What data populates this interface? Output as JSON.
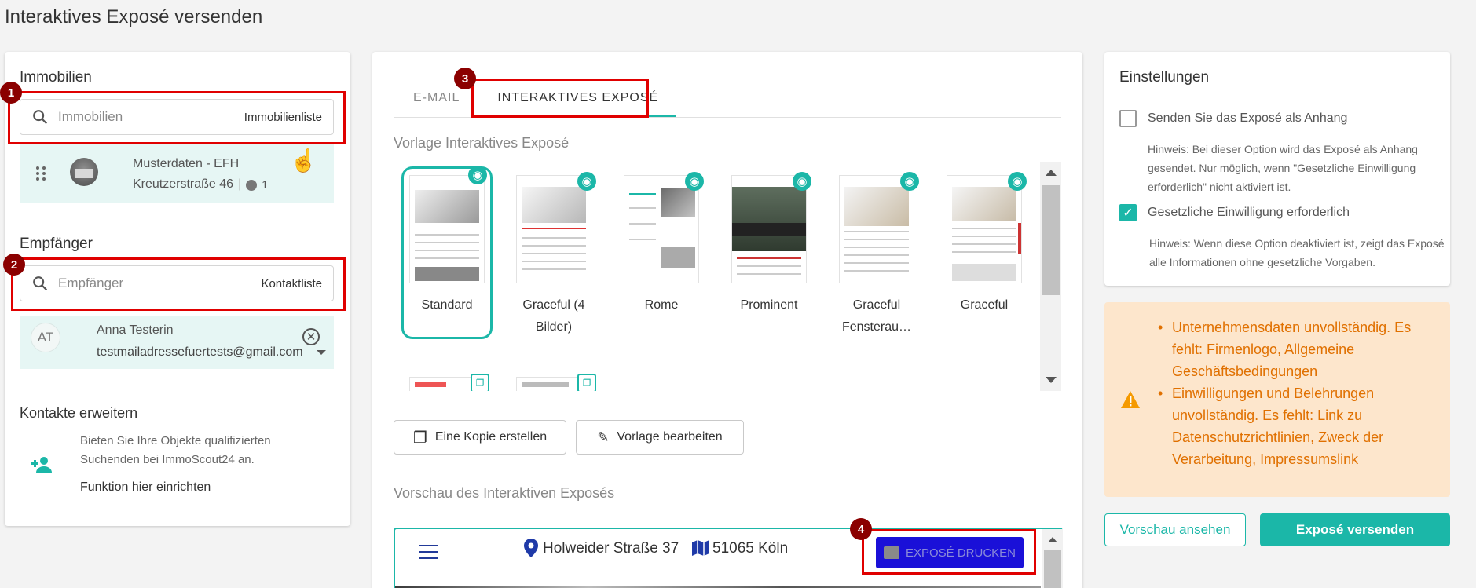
{
  "page_title": "Interaktives Exposé versenden",
  "left": {
    "immobilien": {
      "title": "Immobilien",
      "search_placeholder": "Immobilien",
      "list_link": "Immobilienliste",
      "item": {
        "name": "Musterdaten - EFH",
        "address": "Kreutzerstraße 46",
        "count": "1"
      }
    },
    "empfaenger": {
      "title": "Empfänger",
      "search_placeholder": "Empfänger",
      "list_link": "Kontaktliste",
      "item": {
        "initials": "AT",
        "name": "Anna Testerin",
        "email": "testmailadressefuertests@gmail.com"
      }
    },
    "kontakte": {
      "title": "Kontakte erweitern",
      "text": "Bieten Sie Ihre Objekte qualifizierten Suchenden bei ImmoScout24 an.",
      "link": "Funktion hier einrichten"
    }
  },
  "markers": {
    "m1": "1",
    "m2": "2",
    "m3": "3",
    "m4": "4"
  },
  "middle": {
    "tabs": [
      {
        "label": "E-MAIL"
      },
      {
        "label": "INTERAKTIVES EXPOSÉ"
      }
    ],
    "vorlage_title": "Vorlage Interaktives Exposé",
    "templates": [
      {
        "name": "Standard"
      },
      {
        "name": "Graceful (4 Bilder)"
      },
      {
        "name": "Rome"
      },
      {
        "name": "Prominent"
      },
      {
        "name": "Graceful Fensterau…"
      },
      {
        "name": "Graceful"
      }
    ],
    "copy_button": "Eine Kopie erstellen",
    "edit_button": "Vorlage bearbeiten",
    "preview_title": "Vorschau des Interaktiven Exposés",
    "preview": {
      "street": "Holweider Straße 37",
      "city": "51065 Köln",
      "print_button": "EXPOSÉ DRUCKEN"
    }
  },
  "right": {
    "settings_title": "Einstellungen",
    "opt1_label": "Senden Sie das Exposé als Anhang",
    "opt1_hint": "Hinweis: Bei dieser Option wird das Exposé als Anhang gesendet. Nur möglich, wenn \"Gesetzliche Einwilligung erforderlich\" nicht aktiviert ist.",
    "opt2_label": "Gesetzliche Einwilligung erforderlich",
    "opt2_hint": "Hinweis: Wenn diese Option deaktiviert ist, zeigt das Exposé alle Informationen ohne gesetzliche Vorgaben.",
    "warnings": [
      "Unternehmensdaten unvollständig. Es fehlt: Firmenlogo, Allgemeine Geschäftsbedingungen",
      "Einwilligungen und Belehrungen unvollständig. Es fehlt: Link zu Datenschutzrichtlinien, Zweck der Verarbeitung, Impressumslink"
    ],
    "preview_button": "Vorschau ansehen",
    "send_button": "Exposé versenden"
  },
  "colors": {
    "accent": "#1bb7a8",
    "warning": "#e07000",
    "annotation": "#e00000"
  }
}
